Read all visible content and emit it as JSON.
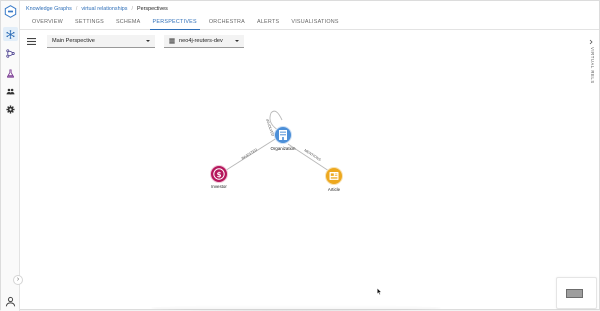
{
  "breadcrumb": {
    "items": [
      "Knowledge Graphs",
      "virtual relationships"
    ],
    "current": "Perspectives",
    "separator": "/"
  },
  "tabs": [
    {
      "label": "OVERVIEW",
      "active": false
    },
    {
      "label": "SETTINGS",
      "active": false
    },
    {
      "label": "SCHEMA",
      "active": false
    },
    {
      "label": "PERSPECTIVES",
      "active": true
    },
    {
      "label": "ORCHESTRA",
      "active": false
    },
    {
      "label": "ALERTS",
      "active": false
    },
    {
      "label": "VISUALISATIONS",
      "active": false
    }
  ],
  "toolbar": {
    "menu_icon": "hamburger-menu-icon",
    "perspective_value": "Main Perspective",
    "database_value": "neo4j-reuters-dev",
    "database_icon": "database-icon"
  },
  "side_panel": {
    "label": "VIRTUAL RELS"
  },
  "sidebar": {
    "items": [
      {
        "icon": "hub-network-icon",
        "active": true
      },
      {
        "icon": "flow-branch-icon",
        "active": false
      },
      {
        "icon": "flask-icon",
        "active": false
      },
      {
        "icon": "people-icon",
        "active": false
      },
      {
        "icon": "gear-icon",
        "active": false
      }
    ],
    "bottom_icon": "user-icon",
    "expand_icon": "chevron-right-icon"
  },
  "graph": {
    "nodes": [
      {
        "id": "organization",
        "label": "Organization",
        "icon": "building-icon",
        "color": "#4c8fd8"
      },
      {
        "id": "investor",
        "label": "Investor",
        "icon": "dollar-icon",
        "color": "#b5175c"
      },
      {
        "id": "article",
        "label": "Article",
        "icon": "newspaper-icon",
        "color": "#eda81f"
      }
    ],
    "edges": [
      {
        "from": "investor",
        "to": "organization",
        "label": "INVESTED"
      },
      {
        "from": "organization",
        "to": "article",
        "label": "MENTIONS"
      },
      {
        "from": "organization",
        "to": "organization",
        "label": "INVOLVED"
      }
    ]
  },
  "colors": {
    "accent": "#2f6fb8",
    "organization": "#4c8fd8",
    "investor": "#b5175c",
    "article": "#eda81f"
  }
}
